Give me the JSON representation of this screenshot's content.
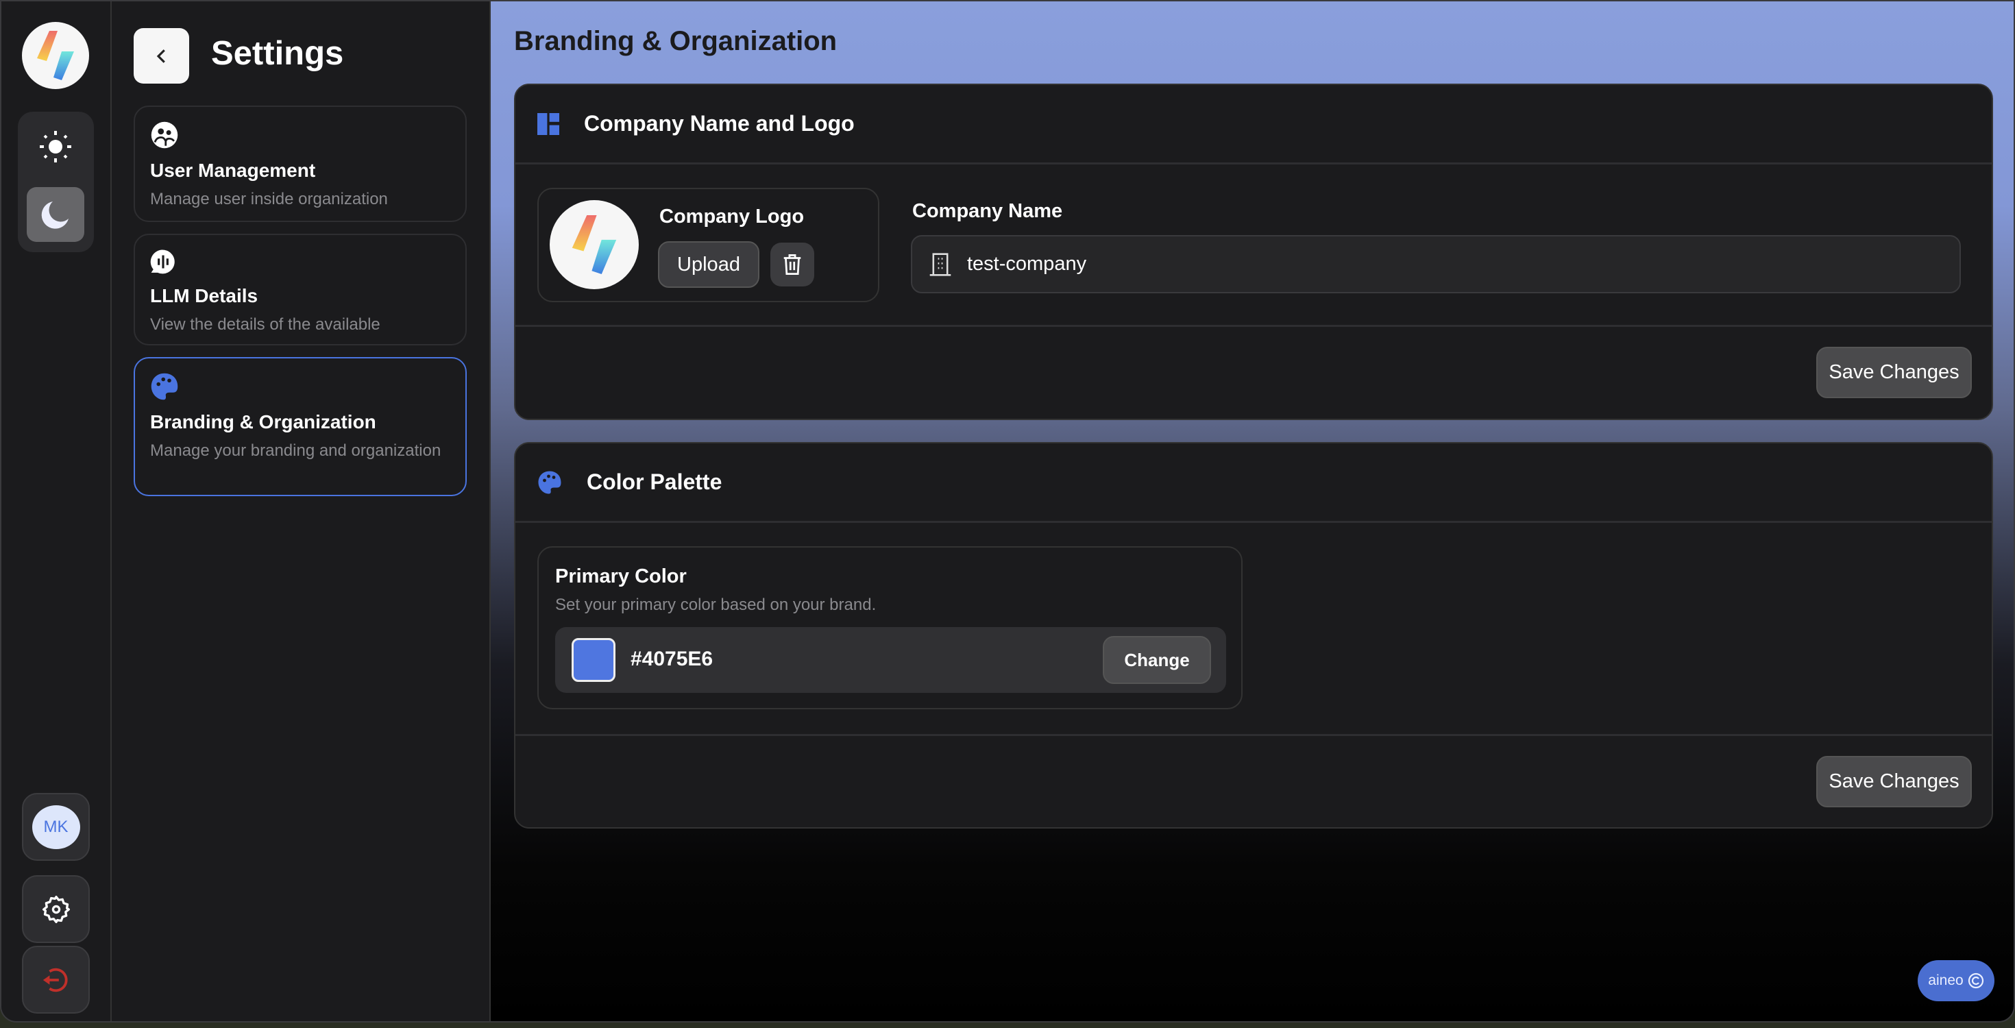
{
  "rail": {
    "user_initials": "MK"
  },
  "sidebar": {
    "title": "Settings",
    "items": [
      {
        "label": "User Management",
        "description": "Manage user inside organization"
      },
      {
        "label": "LLM Details",
        "description": "View the details of the available"
      },
      {
        "label": "Branding & Organization",
        "description": "Manage your branding and organization"
      }
    ]
  },
  "main": {
    "title": "Branding & Organization",
    "company_section": {
      "title": "Company Name and Logo",
      "logo_label": "Company Logo",
      "upload_label": "Upload",
      "name_label": "Company Name",
      "name_value": "test-company",
      "save_label": "Save Changes"
    },
    "palette_section": {
      "title": "Color Palette",
      "primary_label": "Primary Color",
      "primary_description": "Set your primary color based on your brand.",
      "primary_value": "#4075E6",
      "change_label": "Change",
      "save_label": "Save Changes"
    },
    "footer_badge": "aineo"
  },
  "colors": {
    "accent": "#4075E6",
    "danger": "#c0302a"
  }
}
